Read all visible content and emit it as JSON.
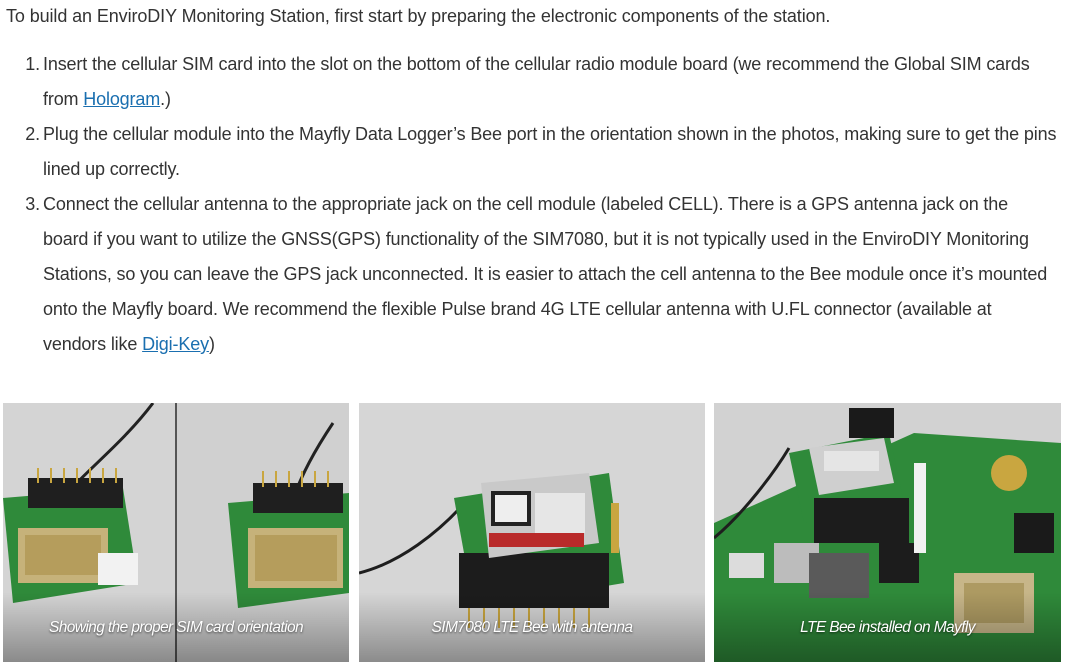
{
  "intro": "To build an EnviroDIY Monitoring Station, first start by preparing the electronic components of the station.",
  "steps": [
    {
      "number": "1.",
      "text_before": "Insert the cellular SIM card into the slot on the bottom of the cellular radio module board (we recommend the Global SIM cards from ",
      "link": "Hologram",
      "text_after": ".)"
    },
    {
      "number": "2.",
      "text": "Plug the cellular module into the Mayfly Data Logger’s Bee port in the orientation shown in the photos, making sure to get the pins lined up correctly."
    },
    {
      "number": "3.",
      "text_before": "Connect the cellular antenna to the appropriate jack on the cell module (labeled CELL). There is a GPS antenna jack on the board if you want to utilize the GNSS(GPS) functionality of the SIM7080, but it is not typically used in the EnviroDIY Monitoring Stations, so you can leave the GPS jack unconnected. It is easier to attach the cell antenna to the Bee module once it’s mounted onto the Mayfly board. We recommend the flexible Pulse brand 4G LTE cellular antenna with U.FL connector (available at vendors like ",
      "link": "Digi-Key",
      "text_after": ")"
    }
  ],
  "gallery": [
    {
      "caption": "Showing the proper SIM card orientation"
    },
    {
      "caption": "SIM7080 LTE Bee with antenna"
    },
    {
      "caption": "LTE Bee installed on Mayfly"
    }
  ],
  "colors": {
    "link": "#1a6fb0",
    "body_text": "#333333",
    "pcb_green": "#2f8a3a"
  }
}
